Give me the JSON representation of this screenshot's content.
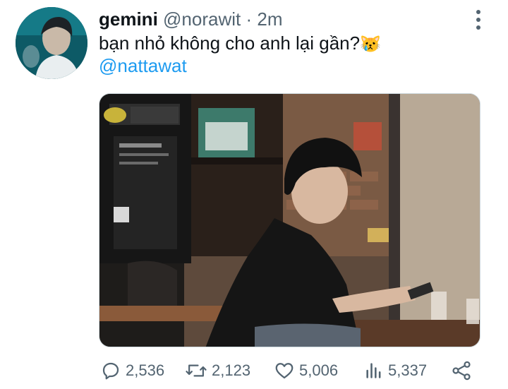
{
  "tweet": {
    "display_name": "gemini",
    "handle": "@norawit",
    "separator": "·",
    "time": "2m",
    "text": "bạn nhỏ không cho anh lại gần?",
    "emoji": "😿",
    "mention": "@nattawat"
  },
  "actions": {
    "replies": "2,536",
    "retweets": "2,123",
    "likes": "5,006",
    "views": "5,337"
  },
  "colors": {
    "link": "#1d9bf0",
    "secondary_text": "#536471",
    "primary_text": "#0f1419"
  }
}
